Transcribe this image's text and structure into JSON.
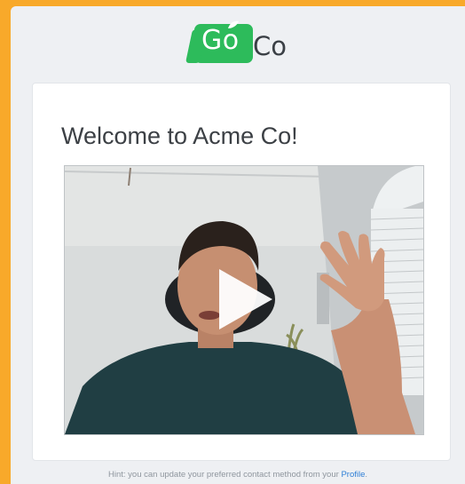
{
  "logo": {
    "part1": "Go",
    "part2": "Co",
    "brand_color": "#2dbb5b"
  },
  "main": {
    "title": "Welcome to Acme Co!",
    "video": {
      "icon": "play-icon"
    }
  },
  "footer": {
    "hint_text": "Hint: you can update your preferred contact method from your",
    "profile_link": "Profile",
    "period": "."
  },
  "colors": {
    "frame": "#f8a92a",
    "background": "#eef0f3",
    "link": "#2f7fd6"
  }
}
